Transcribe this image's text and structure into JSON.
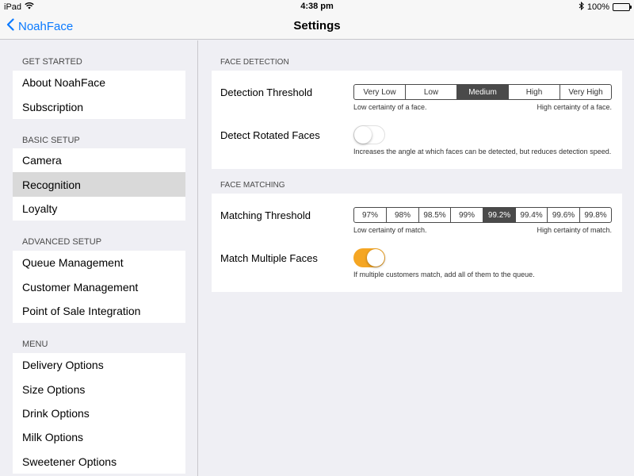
{
  "status_bar": {
    "device": "iPad",
    "wifi_icon": "wifi-icon",
    "time": "4:38 pm",
    "bluetooth_icon": "bluetooth-icon",
    "battery_text": "100%",
    "battery_level": 1.0,
    "battery_color": "#4cd964"
  },
  "nav": {
    "back_label": "NoahFace",
    "title": "Settings",
    "tint_color": "#0a7aff"
  },
  "sidebar": {
    "sections": [
      {
        "header": "GET STARTED",
        "items": [
          {
            "label": "About NoahFace"
          },
          {
            "label": "Subscription"
          }
        ]
      },
      {
        "header": "BASIC SETUP",
        "items": [
          {
            "label": "Camera"
          },
          {
            "label": "Recognition",
            "selected": true
          },
          {
            "label": "Loyalty"
          }
        ]
      },
      {
        "header": "ADVANCED SETUP",
        "items": [
          {
            "label": "Queue Management"
          },
          {
            "label": "Customer Management"
          },
          {
            "label": "Point of Sale Integration"
          }
        ]
      },
      {
        "header": "MENU",
        "items": [
          {
            "label": "Delivery Options"
          },
          {
            "label": "Size Options"
          },
          {
            "label": "Drink Options"
          },
          {
            "label": "Milk Options"
          },
          {
            "label": "Sweetener Options"
          }
        ]
      }
    ]
  },
  "detail": {
    "face_detection": {
      "header": "FACE DETECTION",
      "threshold_label": "Detection Threshold",
      "threshold_options": [
        "Very Low",
        "Low",
        "Medium",
        "High",
        "Very High"
      ],
      "threshold_selected": "Medium",
      "threshold_hint_low": "Low certainty of a face.",
      "threshold_hint_high": "High certainty of a face.",
      "rotated_label": "Detect Rotated Faces",
      "rotated_on": false,
      "rotated_hint": "Increases the angle at which faces can be detected, but reduces detection speed."
    },
    "face_matching": {
      "header": "FACE MATCHING",
      "threshold_label": "Matching Threshold",
      "threshold_options": [
        "97%",
        "98%",
        "98.5%",
        "99%",
        "99.2%",
        "99.4%",
        "99.6%",
        "99.8%"
      ],
      "threshold_selected": "99.2%",
      "threshold_hint_low": "Low certainty of match.",
      "threshold_hint_high": "High certainty of match.",
      "multiple_label": "Match Multiple Faces",
      "multiple_on": true,
      "multiple_hint": "If multiple customers match, add all of them to the queue.",
      "toggle_on_color": "#f5a623"
    }
  }
}
